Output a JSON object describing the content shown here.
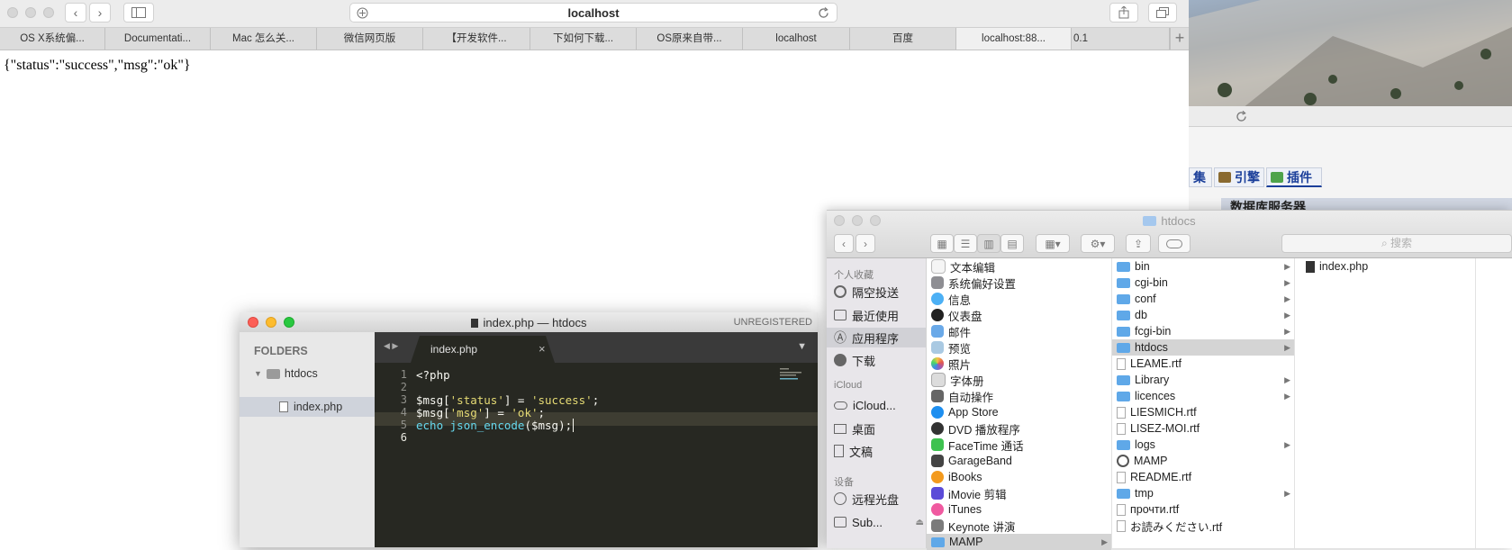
{
  "browser": {
    "address": "localhost",
    "tabs": [
      "OS X系统偏...",
      "Documentati...",
      "Mac 怎么关...",
      "微信网页版",
      "【开发软件...",
      "下如何下载...",
      "OS原来自带...",
      "localhost",
      "百度",
      "localhost:88...",
      "0.1"
    ],
    "page_text": "{\"status\":\"success\",\"msg\":\"ok\"}"
  },
  "bg_window": {
    "tabs": [
      "集",
      "引擎",
      "插件"
    ],
    "heading": "数据库服务器"
  },
  "sublime": {
    "title": "index.php — htdocs",
    "unregistered": "UNREGISTERED",
    "sidebar_heading": "FOLDERS",
    "folder": "htdocs",
    "file": "index.php",
    "tab": "index.php",
    "tab_close": "×",
    "line_numbers": [
      "1",
      "2",
      "3",
      "4",
      "5",
      "6"
    ],
    "code": {
      "l1": "<?php",
      "l3_var": "$msg[",
      "l3_key": "'status'",
      "l3_mid": "] = ",
      "l3_val": "'success'",
      "l3_end": ";",
      "l4_var": "$msg[",
      "l4_key": "'msg'",
      "l4_mid": "] = ",
      "l4_val": "'ok'",
      "l4_end": ";",
      "l6_kw": "echo ",
      "l6_fn": "json_encode",
      "l6_rest": "($msg);"
    }
  },
  "finder": {
    "title": "htdocs",
    "search_placeholder": "搜索",
    "sidebar": {
      "favorites_heading": "个人收藏",
      "favorites": [
        "隔空投送",
        "最近使用",
        "应用程序",
        "下载"
      ],
      "icloud_heading": "iCloud",
      "icloud": [
        "iCloud...",
        "桌面",
        "文稿"
      ],
      "devices_heading": "设备",
      "devices": [
        "远程光盘",
        "Sub..."
      ]
    },
    "apps": [
      "文本编辑",
      "系统偏好设置",
      "信息",
      "仪表盘",
      "邮件",
      "预览",
      "照片",
      "字体册",
      "自动操作",
      "App Store",
      "DVD 播放程序",
      "FaceTime 通话",
      "GarageBand",
      "iBooks",
      "iMovie 剪辑",
      "iTunes",
      "Keynote 讲演",
      "MAMP"
    ],
    "mamp": [
      {
        "name": "bin",
        "kind": "folder"
      },
      {
        "name": "cgi-bin",
        "kind": "folder"
      },
      {
        "name": "conf",
        "kind": "folder"
      },
      {
        "name": "db",
        "kind": "folder"
      },
      {
        "name": "fcgi-bin",
        "kind": "folder"
      },
      {
        "name": "htdocs",
        "kind": "folder"
      },
      {
        "name": "LEAME.rtf",
        "kind": "file"
      },
      {
        "name": "Library",
        "kind": "folder"
      },
      {
        "name": "licences",
        "kind": "folder"
      },
      {
        "name": "LIESMICH.rtf",
        "kind": "file"
      },
      {
        "name": "LISEZ-MOI.rtf",
        "kind": "file"
      },
      {
        "name": "logs",
        "kind": "folder"
      },
      {
        "name": "MAMP",
        "kind": "app"
      },
      {
        "name": "README.rtf",
        "kind": "file"
      },
      {
        "name": "tmp",
        "kind": "folder"
      },
      {
        "name": "прочти.rtf",
        "kind": "file"
      },
      {
        "name": "お読みください.rtf",
        "kind": "file"
      }
    ],
    "htdocs_items": [
      "index.php"
    ]
  }
}
